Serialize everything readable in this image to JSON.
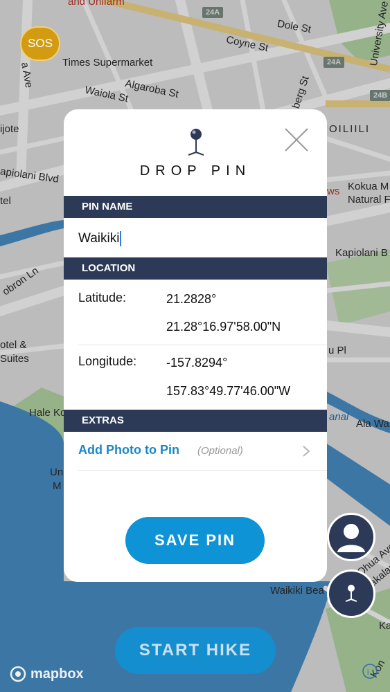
{
  "map": {
    "sos_label": "SOS",
    "labels": {
      "unifarm": "and Unifarm",
      "dole": "Dole St",
      "university": "University Ave",
      "coyne": "Coyne St",
      "times": "Times Supermarket",
      "algaroba": "Algaroba St",
      "waiola": "Waiola St",
      "berg": "berg St",
      "moiliili": "OILIILI",
      "ala": "a Ave",
      "ijote": "ijote",
      "kapiolani_left": "apiolani Blvd",
      "tel": "tel",
      "news": "ws",
      "kokua": "Kokua M",
      "natural": "Natural F",
      "kapiolani_right": "Kapiolani B",
      "dbron": "obron Ln",
      "hotel": "otel &",
      "suites": "Suites",
      "upl": "u Pl",
      "hale": "Hale Ko",
      "canal": "anal",
      "alawa": "Ala Wa",
      "un": "Un",
      "m": "M",
      "ohua": "Ohua Ave",
      "kalakau": "akalau",
      "waikiki_beach": "Waikiki Bea",
      "ka": "Ka",
      "kon": "Kon"
    },
    "shields": [
      "24A",
      "24A",
      "24B"
    ],
    "attribution": "mapbox"
  },
  "modal": {
    "title": "DROP PIN",
    "sections": {
      "pin_name": "PIN NAME",
      "location": "LOCATION",
      "extras": "EXTRAS"
    },
    "pin_name_value": "Waikiki",
    "latitude": {
      "label": "Latitude:",
      "decimal": "21.2828°",
      "dms": "21.28°16.97'58.00\"N"
    },
    "longitude": {
      "label": "Longitude:",
      "decimal": "-157.8294°",
      "dms": "157.83°49.77'46.00\"W"
    },
    "add_photo": {
      "label": "Add Photo to Pin",
      "hint": "(Optional)"
    },
    "save_label": "SAVE PIN"
  },
  "bottom": {
    "start_label": "START HIKE"
  },
  "colors": {
    "navy": "#2c3a57",
    "accent": "#0e93d6",
    "link": "#1a86c9",
    "sos": "#d39b12",
    "water": "#4a90c8",
    "park": "#b8d9a8"
  },
  "icons": [
    "pin-icon",
    "close-icon",
    "chevron-right-icon",
    "avatar-icon",
    "map-pin-icon",
    "mapbox-logo-icon",
    "compass-icon"
  ]
}
